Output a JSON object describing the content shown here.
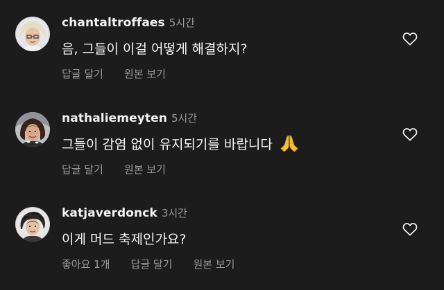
{
  "comments": [
    {
      "username": "chantaltroffaes",
      "time": "5시간",
      "text": "음, 그들이 이걸 어떻게 해결하지?",
      "reply_label": "답글 달기",
      "view_original_label": "원본 보기"
    },
    {
      "username": "nathaliemeyten",
      "time": "5시간",
      "text": "그들이 감염 없이 유지되기를 바랍니다",
      "emoji": "folded-hands",
      "reply_label": "답글 달기",
      "view_original_label": "원본 보기"
    },
    {
      "username": "katjaverdonck",
      "time": "3시간",
      "text": "이게 머드 축제인가요?",
      "likes_label": "좋아요 1개",
      "reply_label": "답글 달기",
      "view_original_label": "원본 보기"
    }
  ],
  "colors": {
    "background": "#1c1c1c",
    "primary_text": "#f5f5f5",
    "secondary_text": "#9a9a9a",
    "emoji_yellow": "#f4c23a"
  }
}
